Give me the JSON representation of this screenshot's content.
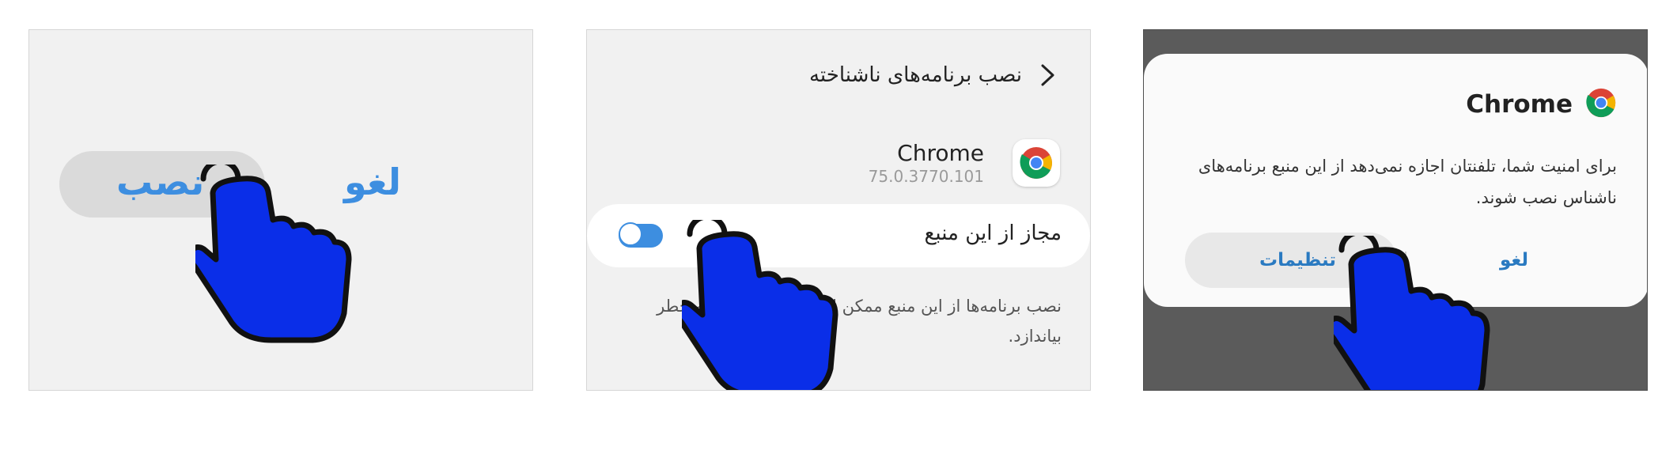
{
  "panel_install": {
    "install_label": "نصب",
    "cancel_label": "لغو"
  },
  "panel_unknown_sources": {
    "back_icon": "chevron-right-icon",
    "title": "نصب برنامه‌های ناشناخته",
    "app": {
      "name": "Chrome",
      "version": "75.0.3770.101",
      "icon": "chrome-icon"
    },
    "toggle": {
      "label": "مجاز از این منبع",
      "state": "off"
    },
    "warning": "نصب برنامه‌ها از این منبع ممکن است تلفن شما را به خطر بیاندازد."
  },
  "panel_dialog": {
    "app_name": "Chrome",
    "app_icon": "chrome-icon",
    "message": "برای امنیت شما، تلفنتان اجازه نمی‌دهد از این منبع برنامه‌های ناشناس نصب شوند.",
    "settings_label": "تنظیمات",
    "cancel_label": "لغو"
  },
  "colors": {
    "accent": "#3d8ee0",
    "hand_fill": "#0a2ee8",
    "panel_bg": "#f1f1f1",
    "dim_overlay": "#5b5b5b"
  }
}
